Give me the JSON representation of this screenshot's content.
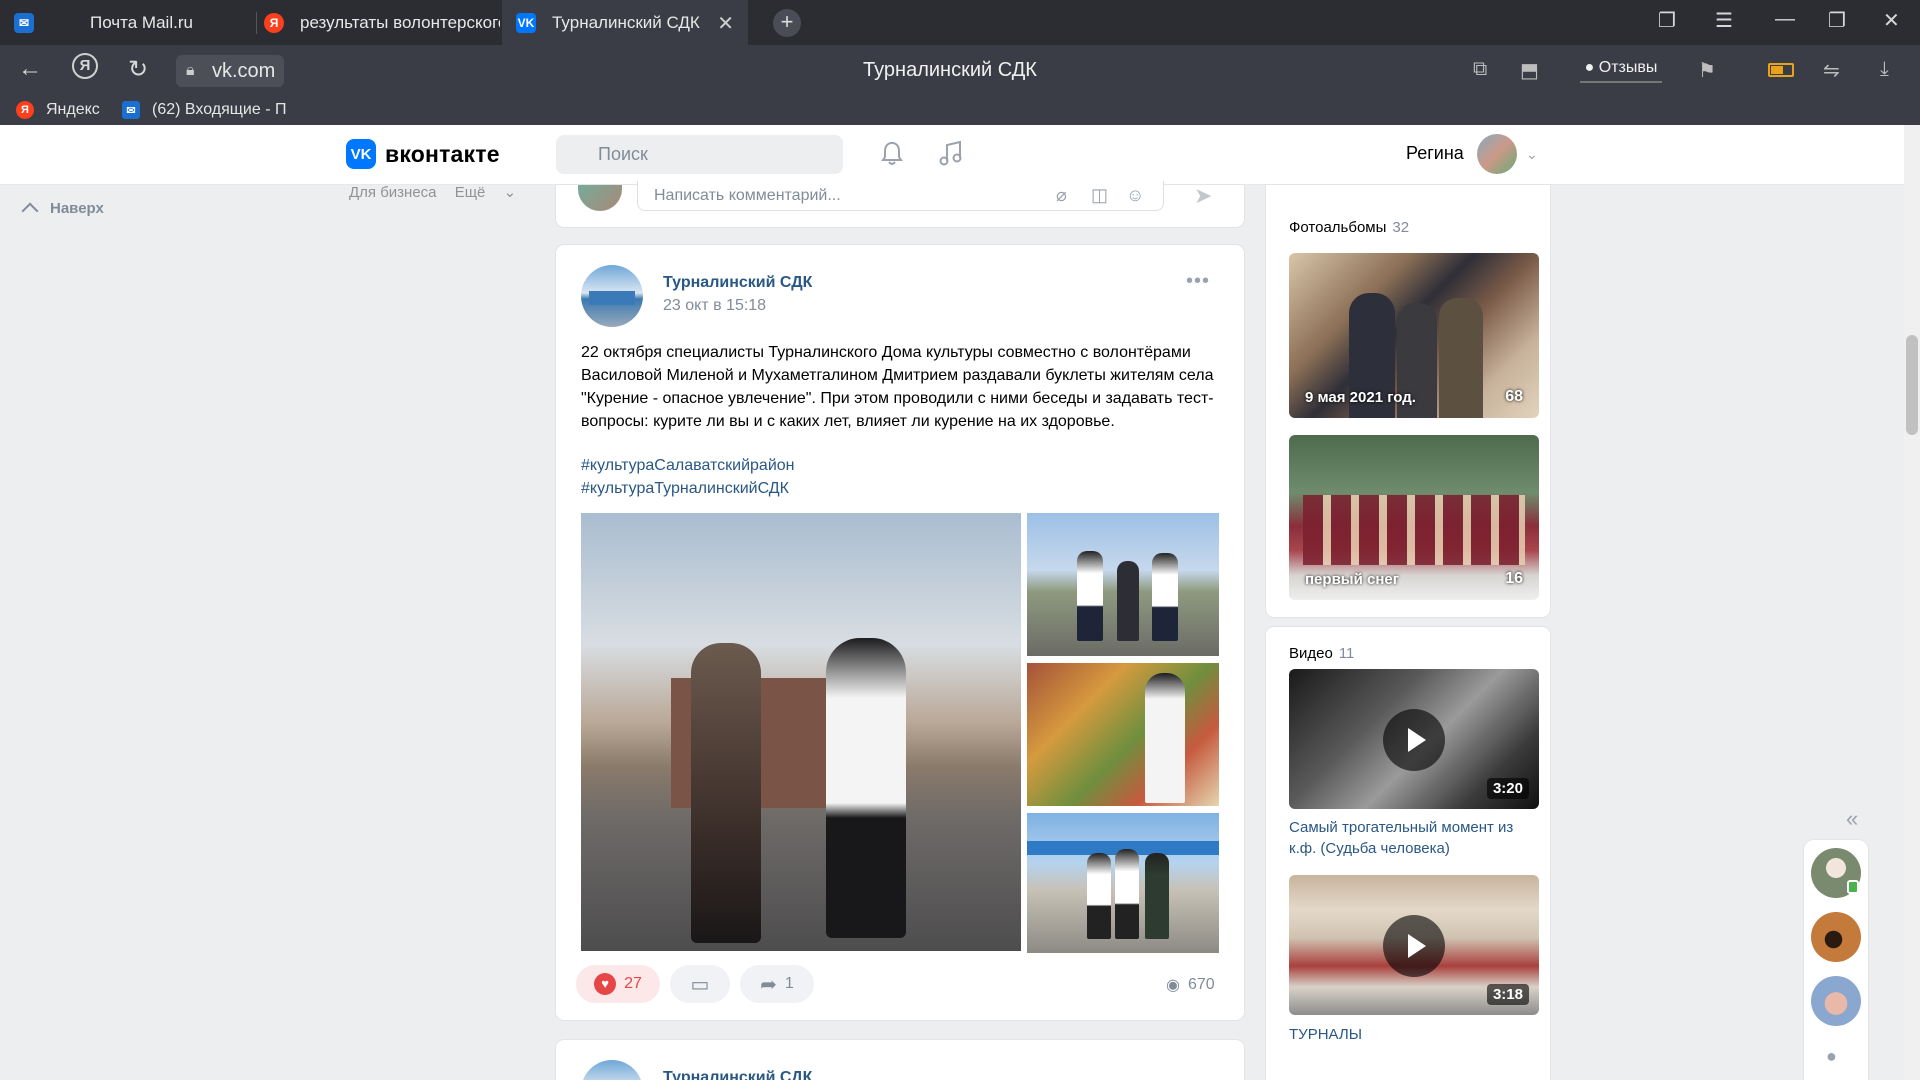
{
  "browser": {
    "tabs": [
      {
        "label": "Почта Mail.ru",
        "favicon": "mail-envelope-icon"
      },
      {
        "label": "результаты волонтерского",
        "favicon": "yandex-icon"
      },
      {
        "label": "Турналинский СДК",
        "favicon": "vk-icon"
      }
    ],
    "url": "vk.com",
    "page_title": "Турналинский СДК",
    "reviews_label": "Отзывы",
    "bookmarks": [
      {
        "label": "Яндекс"
      },
      {
        "label": "(62) Входящие - П"
      }
    ]
  },
  "vk": {
    "logo_text": "вконтакте",
    "search_placeholder": "Поиск",
    "user_name": "Регина",
    "back_to_top": "Наверх",
    "footer_links": [
      "Для бизнеса",
      "Ещё"
    ]
  },
  "comment": {
    "placeholder": "Написать комментарий..."
  },
  "post": {
    "author": "Турналинский СДК",
    "date": "23 окт в 15:18",
    "text": "22 октября специалисты Турналинского Дома культуры совместно с волонтёрами Василовой Миленой и Мухаметгалином Дмитрием раздавали буклеты жителям села \"Курение - опасное увлечение\". При этом проводили с ними беседы и задавать тест-вопросы: курите ли вы и с каких лет, влияет ли курение на их здоровье.",
    "hashtags": [
      "#культураСалаватскийрайон",
      "#культураТурналинскийСДК"
    ],
    "likes": "27",
    "shares": "1",
    "views": "670"
  },
  "next_post": {
    "author": "Турналинский СДК"
  },
  "sidebar": {
    "albums_title": "Фотоальбомы",
    "albums_count": "32",
    "albums": [
      {
        "label": "9 мая 2021 год.",
        "count": "68"
      },
      {
        "label": "первый снег",
        "count": "16"
      }
    ],
    "videos_title": "Видео",
    "videos_count": "11",
    "videos": [
      {
        "title": "Самый трогательный момент из к.ф. (Судьба человека)",
        "duration": "3:20"
      },
      {
        "title": "ТУРНАЛЫ",
        "duration": "3:18"
      }
    ]
  },
  "colors": {
    "vk_blue": "#0077ff",
    "link": "#2a5885",
    "like_red": "#e64646",
    "chrome_dark": "#3a3d45"
  }
}
